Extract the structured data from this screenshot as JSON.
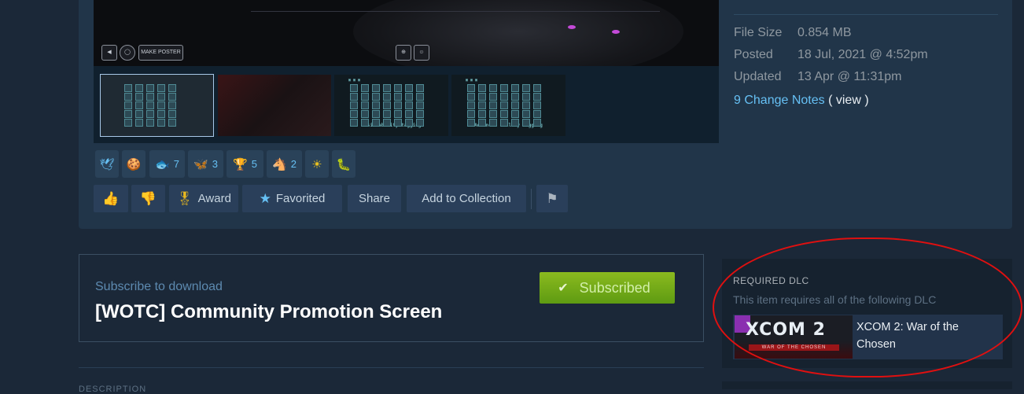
{
  "video": {
    "make_poster_label": "MAKE POSTER"
  },
  "thumbnails": [
    {
      "caption": ""
    },
    {
      "caption": ""
    },
    {
      "caption": "Basic ability tagging"
    },
    {
      "caption": "Advanced ability tagging"
    }
  ],
  "awards": [
    {
      "icon": "dove-award-icon",
      "glyph": "🕊",
      "count": ""
    },
    {
      "icon": "clap-award-icon",
      "glyph": "🍪",
      "count": ""
    },
    {
      "icon": "fish-award-icon",
      "glyph": "🐟",
      "count": "7"
    },
    {
      "icon": "wings-award-icon",
      "glyph": "🦋",
      "count": "3"
    },
    {
      "icon": "trophy-award-icon",
      "glyph": "🏆",
      "count": "5"
    },
    {
      "icon": "horse-award-icon",
      "glyph": "🐴",
      "count": "2"
    },
    {
      "icon": "sun-award-icon",
      "glyph": "☀",
      "count": ""
    },
    {
      "icon": "worm-award-icon",
      "glyph": "🐛",
      "count": ""
    }
  ],
  "actions": {
    "award_label": "Award",
    "favorited_label": "Favorited",
    "share_label": "Share",
    "collection_label": "Add to Collection"
  },
  "details": {
    "file_size_label": "File Size",
    "file_size_value": "0.854 MB",
    "posted_label": "Posted",
    "posted_value": "18 Jul, 2021 @ 4:52pm",
    "updated_label": "Updated",
    "updated_value": "13 Apr @ 11:31pm",
    "change_notes_link": "9 Change Notes",
    "view_link": "( view )"
  },
  "subscribe": {
    "label": "Subscribe to download",
    "title": "[WOTC] Community Promotion Screen",
    "button_label": "Subscribed"
  },
  "description_label": "DESCRIPTION",
  "required_dlc": {
    "heading": "REQUIRED DLC",
    "subtext": "This item requires all of the following DLC",
    "item_name": "XCOM 2: War of the Chosen",
    "logo_text": "XCOM 2",
    "logo_sub": "WAR OF THE CHOSEN"
  },
  "colors": {
    "accent": "#66c0f4",
    "subscribed_green": "#75b022",
    "annotation_red": "#e01010"
  }
}
